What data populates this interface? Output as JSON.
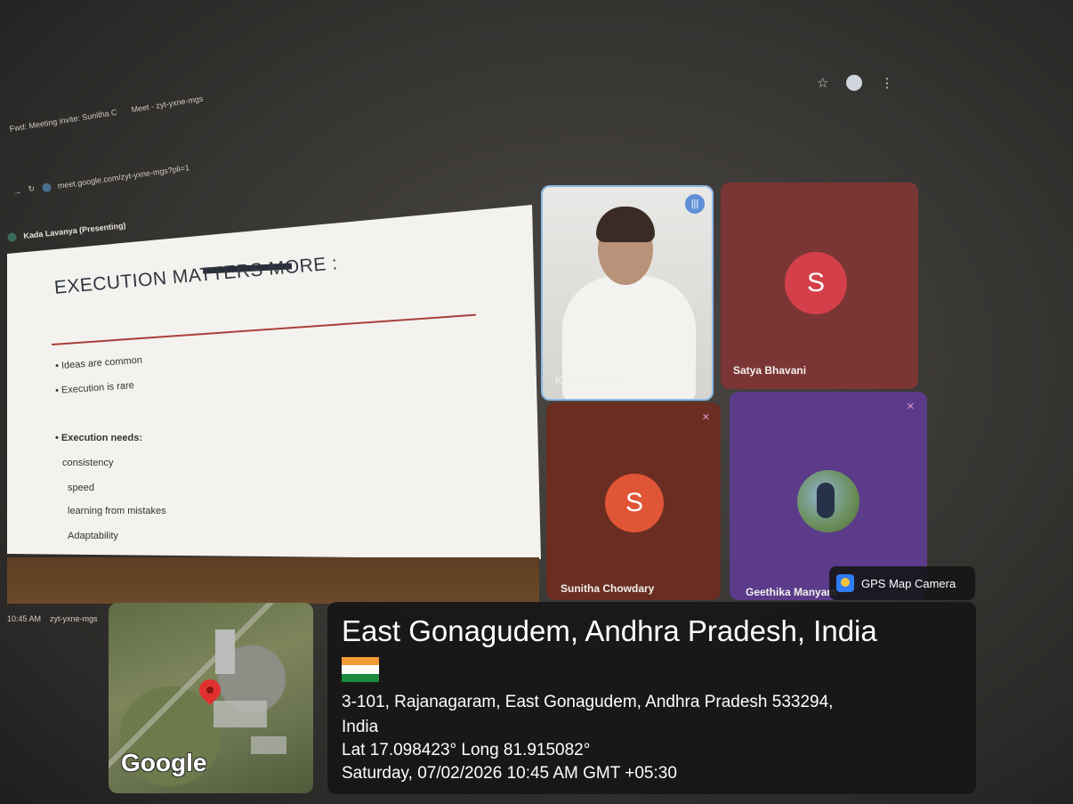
{
  "browser": {
    "tabs": [
      "Fwd: Meeting invite: Sunitha C",
      "Meet - zyt-yxne-mgs"
    ],
    "url": "meet.google.com/zyt-yxne-mgs?pli=1"
  },
  "meet": {
    "presenter_label": "Kada Lavanya (Presenting)",
    "slide": {
      "title": "EXECUTION MATTERS MORE :",
      "bullets": [
        "Ideas are common",
        "Execution is rare"
      ],
      "needs_heading": "Execution needs:",
      "needs": [
        "consistency",
        "speed",
        "learning from mistakes",
        "Adaptability"
      ]
    },
    "participants": [
      {
        "name": "Kada Lavanya",
        "type": "video",
        "speaking": true
      },
      {
        "name": "Satya Bhavani",
        "initial": "S",
        "color": "#d4404a"
      },
      {
        "name": "Sunitha Chowdary",
        "initial": "S",
        "color": "#e05535"
      },
      {
        "name": "Geethika Manyam",
        "type": "photo"
      }
    ],
    "taskbar": {
      "time": "10:45 AM",
      "meeting_code": "zyt-yxne-mgs"
    }
  },
  "gps_overlay": {
    "app_label": "GPS Map Camera",
    "map_brand": "Google",
    "location_title": "East Gonagudem, Andhra Pradesh, India",
    "address_line1": "3-101, Rajanagaram, East Gonagudem, Andhra Pradesh 533294,",
    "address_line2": "India",
    "coordinates": "Lat 17.098423° Long 81.915082°",
    "datetime": "Saturday, 07/02/2026 10:45 AM GMT +05:30"
  }
}
